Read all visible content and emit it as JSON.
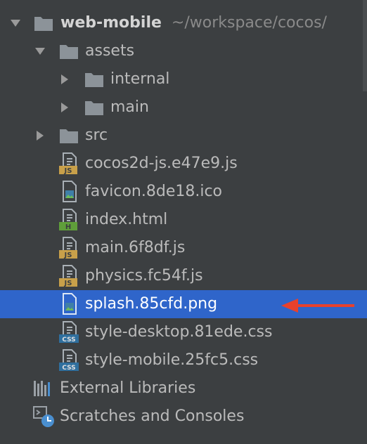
{
  "root": {
    "name": "web-mobile",
    "path": "~/workspace/cocos/"
  },
  "folders": {
    "assets": "assets",
    "internal": "internal",
    "main": "main",
    "src": "src"
  },
  "files": [
    {
      "name": "cocos2d-js.e47e9.js",
      "badge": "JS"
    },
    {
      "name": "favicon.8de18.ico",
      "badge": ""
    },
    {
      "name": "index.html",
      "badge": "H"
    },
    {
      "name": "main.6f8df.js",
      "badge": "JS"
    },
    {
      "name": "physics.fc54f.js",
      "badge": "JS"
    },
    {
      "name": "splash.85cfd.png",
      "badge": "",
      "selected": true
    },
    {
      "name": "style-desktop.81ede.css",
      "badge": "CSS"
    },
    {
      "name": "style-mobile.25fc5.css",
      "badge": "CSS"
    }
  ],
  "external_libraries": "External Libraries",
  "scratches": "Scratches and Consoles",
  "colors": {
    "background": "#3c3f41",
    "selection": "#2f65ca",
    "folder": "#8c9399",
    "js_badge": "#c8a04a",
    "html_badge": "#5f9e3a",
    "css_badge": "#2f6f9e",
    "annotation_arrow": "#e8412c"
  }
}
